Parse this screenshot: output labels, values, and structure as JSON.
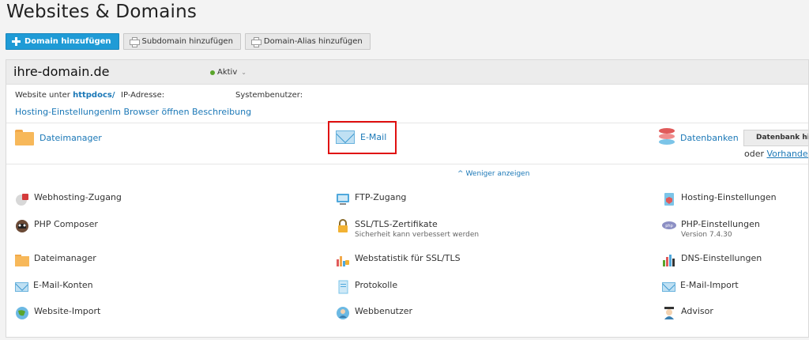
{
  "page": {
    "title": "Websites & Domains"
  },
  "toolbar": {
    "add_domain": "Domain hinzufügen",
    "add_subdomain": "Subdomain hinzufügen",
    "add_alias": "Domain-Alias hinzufügen"
  },
  "domain": {
    "name": "ihre-domain.de",
    "status": "Aktiv",
    "website_prefix": "Website unter",
    "website_dir": "httpdocs/",
    "ip_label": "IP-Adresse:",
    "sysuser_label": "Systembenutzer:",
    "links": {
      "hosting": "Hosting-Einstellungen",
      "browser": "Im Browser öffnen",
      "description": "Beschreibung"
    }
  },
  "big_row": {
    "file_manager": "Dateimanager",
    "email": "E-Mail",
    "databases": "Datenbanken",
    "db_button": "Datenbank hinzufügen",
    "db_or": "oder",
    "db_existing": "Vorhandene Datenbanken"
  },
  "show_less": "Weniger anzeigen",
  "grid": {
    "col1": [
      "Webhosting-Zugang",
      "PHP Composer",
      "Dateimanager",
      "E-Mail-Konten",
      "Website-Import"
    ],
    "col2": [
      "FTP-Zugang",
      "SSL/TLS-Zertifikate",
      "Webstatistik für SSL/TLS",
      "Protokolle",
      "Webbenutzer"
    ],
    "col2_sub": "Sicherheit kann verbessert werden",
    "col3": [
      "Hosting-Einstellungen",
      "PHP-Einstellungen",
      "DNS-Einstellungen",
      "E-Mail-Import",
      "Advisor"
    ],
    "col3_sub": "Version 7.4.30"
  },
  "colors": {
    "primary": "#1f9bd6",
    "link": "#1b78b7",
    "highlight": "#e01010",
    "status": "#5aa52b"
  }
}
